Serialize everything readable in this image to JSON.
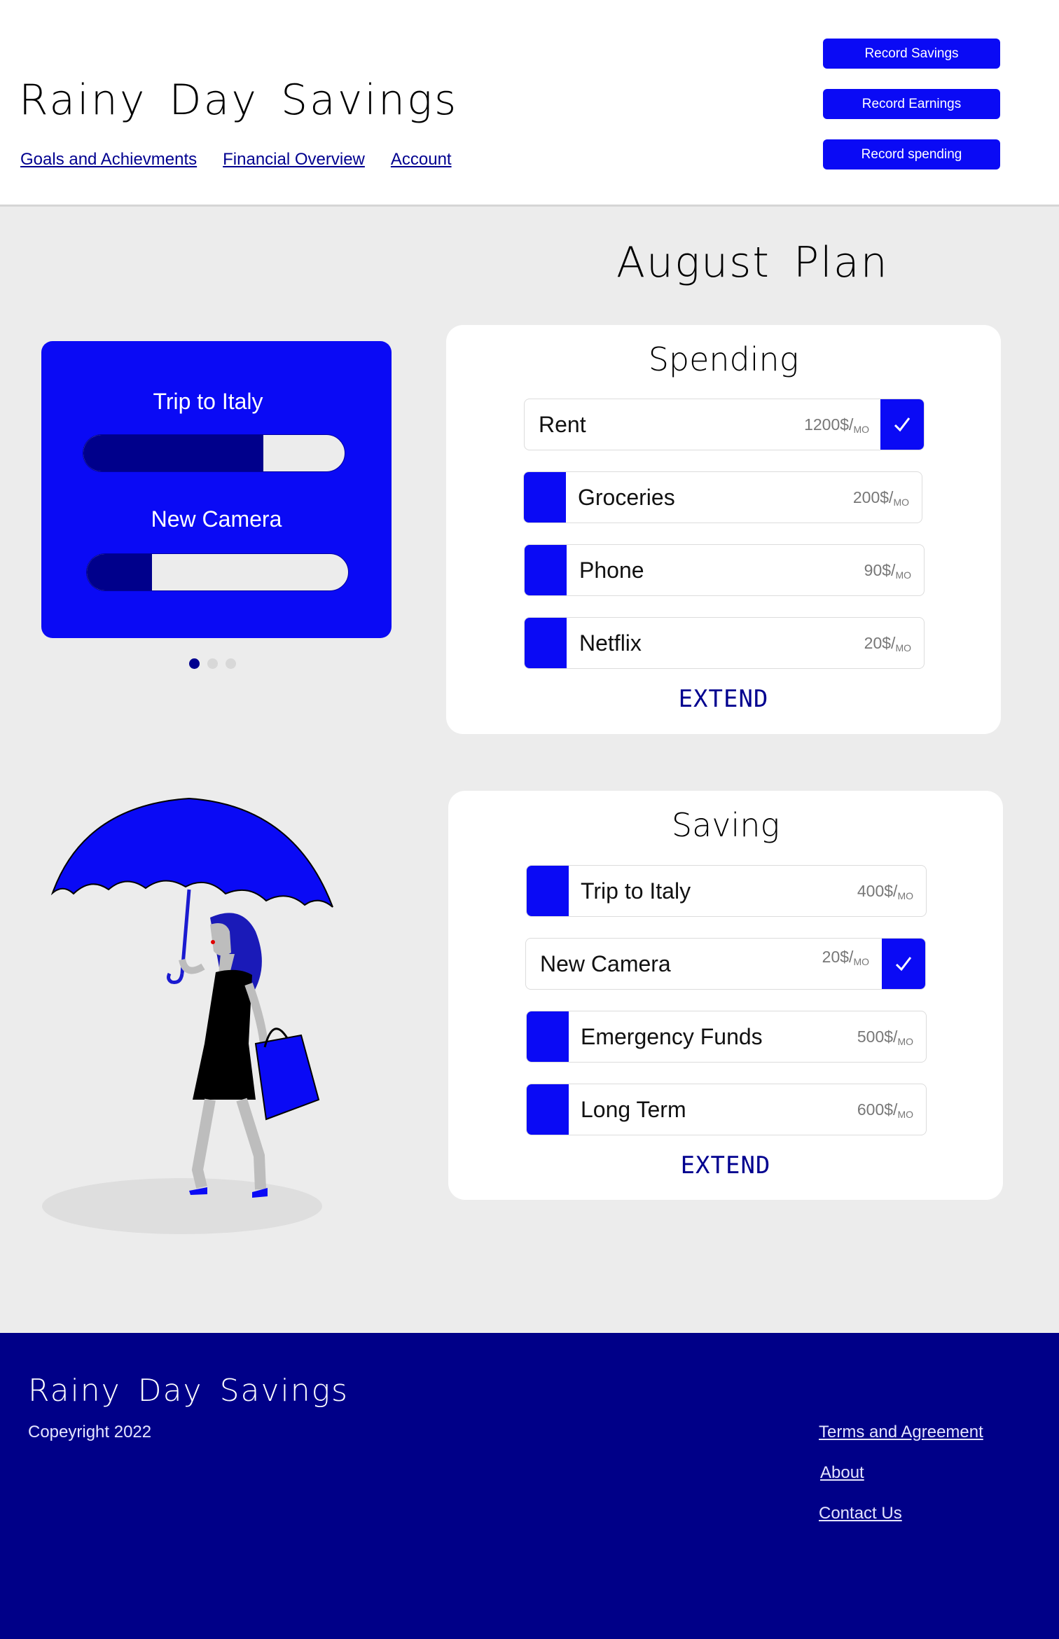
{
  "header": {
    "title": "Rainy Day Savings",
    "nav": [
      "Goals and Achievments",
      "Financial Overview",
      "Account"
    ],
    "buttons": [
      "Record Savings",
      "Record Earnings",
      "Record spending"
    ]
  },
  "plan": {
    "title": "August Plan"
  },
  "goals": {
    "items": [
      {
        "label": "Trip to Italy",
        "progress": 0.69
      },
      {
        "label": "New Camera",
        "progress": 0.25
      }
    ],
    "carousel": {
      "pages": 3,
      "active": 1
    }
  },
  "spending": {
    "heading": "Spending",
    "rows": [
      {
        "name": "Rent",
        "amount": "1200$/",
        "unit": "MO",
        "done": true
      },
      {
        "name": "Groceries",
        "amount": "200$/",
        "unit": "MO",
        "done": false
      },
      {
        "name": "Phone",
        "amount": "90$/",
        "unit": "MO",
        "done": false
      },
      {
        "name": "Netflix",
        "amount": "20$/",
        "unit": "MO",
        "done": false
      }
    ],
    "extend": "EXTEND"
  },
  "saving": {
    "heading": "Saving",
    "rows": [
      {
        "name": "Trip to Italy",
        "amount": "400$/",
        "unit": "MO",
        "done": false
      },
      {
        "name": "New Camera",
        "amount": "20$/",
        "unit": "MO",
        "done": true
      },
      {
        "name": "Emergency Funds",
        "amount": "500$/",
        "unit": "MO",
        "done": false
      },
      {
        "name": "Long Term",
        "amount": "600$/",
        "unit": "MO",
        "done": false
      }
    ],
    "extend": "EXTEND"
  },
  "footer": {
    "title": "Rainy Day Savings",
    "copyright": "Copeyright 2022",
    "links": [
      "Terms and Agreement",
      "About",
      "Contact Us"
    ]
  },
  "colors": {
    "accent": "#0a0af5",
    "navy": "#000088",
    "background": "#ececec"
  },
  "icons": {
    "check": "checkmark-icon"
  }
}
